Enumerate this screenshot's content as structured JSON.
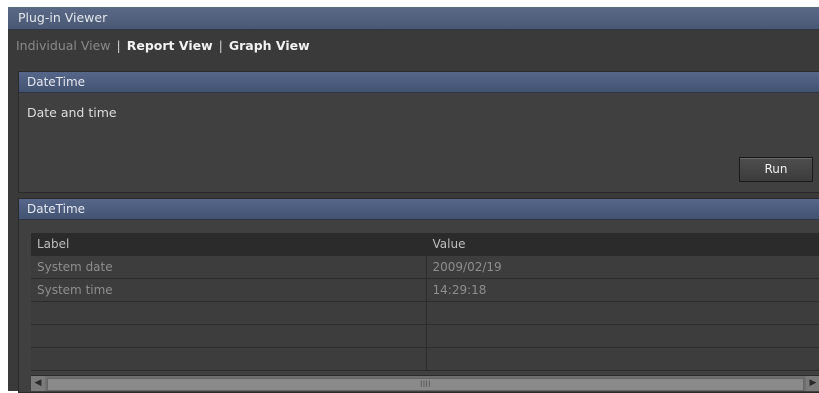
{
  "window": {
    "title": "Plug-in Viewer"
  },
  "tabs": [
    {
      "label": "Individual View",
      "active": true
    },
    {
      "label": "Report View",
      "active": false
    },
    {
      "label": "Graph View",
      "active": false
    }
  ],
  "tab_separator": "|",
  "plugin_panel": {
    "title": "DateTime",
    "description": "Date and time",
    "run_label": "Run"
  },
  "results_panel": {
    "title": "DateTime",
    "columns": [
      "Label",
      "Value"
    ],
    "rows": [
      {
        "label": "System date",
        "value": "2009/02/19"
      },
      {
        "label": "System time",
        "value": "14:29:18"
      }
    ],
    "empty_rows": 3
  },
  "scrollbar": {
    "left_icon": "arrow-left-icon",
    "right_icon": "arrow-right-icon",
    "grip": "IIII"
  },
  "colors": {
    "title_bar": "#4f5f7d",
    "panel_bg": "#404040",
    "window_bg": "#3a3a3a"
  }
}
